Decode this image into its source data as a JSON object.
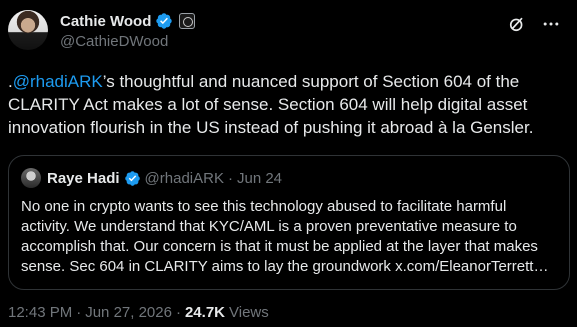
{
  "author": {
    "display_name": "Cathie Wood",
    "handle": "@CathieDWood"
  },
  "tweet": {
    "mention": "@rhadiARK",
    "text_prefix": ".",
    "text_after_mention": "’s thoughtful and nuanced support of Section 604 of the CLARITY Act makes a lot of sense. Section 604 will help digital asset innovation flourish in the US instead of pushing it abroad à la Gensler."
  },
  "quote": {
    "display_name": "Raye Hadi",
    "handle": "@rhadiARK",
    "separator": "·",
    "date": "Jun 24",
    "text": "No one in crypto wants to see this technology abused to facilitate harmful activity. We understand that KYC/AML is a proven preventative measure to accomplish that. Our concern is that it must be applied at the layer that makes sense. Sec 604 in CLARITY aims to lay the groundwork x.com/EleanorTerrett…"
  },
  "footer": {
    "time": "12:43 PM",
    "separator1": "·",
    "date": "Jun 27, 2026",
    "separator2": "·",
    "views_count": "24.7K",
    "views_label": "Views"
  },
  "icons": {
    "verified": "verified-badge-icon",
    "affiliate": "affiliate-badge-icon",
    "grok": "grok-icon",
    "more": "more-icon"
  },
  "colors": {
    "background": "#000000",
    "text": "#e7e9ea",
    "muted": "#71767b",
    "accent": "#1d9bf0",
    "border": "#2f3336"
  }
}
